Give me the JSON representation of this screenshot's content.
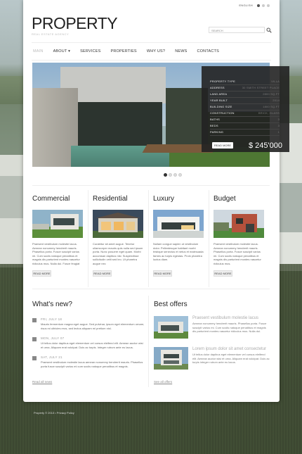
{
  "topbar": {
    "lang_label": "ENGLISH"
  },
  "logo": {
    "name": "PROPERTY",
    "tagline": "REAL ESTATE AGENCY"
  },
  "search": {
    "placeholder": "SEARCH"
  },
  "nav": {
    "items": [
      "MAIN",
      "ABOUT",
      "SERVICES",
      "PROPERTIES",
      "WHY US?",
      "NEWS",
      "CONTACTS"
    ]
  },
  "slider": {
    "info": [
      {
        "key": "PROPERTY TYPE",
        "value": "VILLA"
      },
      {
        "key": "ADDRESS",
        "value": "30 SMITH STREET PLACE"
      },
      {
        "key": "LAND AREA",
        "value": "2800 SQ.FT"
      },
      {
        "key": "YEAR BUILT",
        "value": "2014"
      },
      {
        "key": "BUILDING SIZE",
        "value": "1800 SQ.FT"
      },
      {
        "key": "CONSTRUCTION",
        "value": "BRICK, GLASS"
      },
      {
        "key": "BATHS",
        "value": "3"
      },
      {
        "key": "BEDS",
        "value": "3"
      },
      {
        "key": "PARKING",
        "value": "1"
      }
    ],
    "readmore_label": "READ MORE",
    "price": "$ 245'000"
  },
  "categories": [
    {
      "title": "Commercial",
      "desc": "Praesent vestibulum molestie lacus. Aenean nonummy hendrerit mauris. Phasellus porta. Fusce suscipit varius mi. Cum sociis natoque penatibus et magnis dis parturient montes nascetur ridiculus mus. Nulla dui. Fusce feugiat",
      "readmore": "READ MORE"
    },
    {
      "title": "Residential",
      "desc": "Curabitur sit amet augue. Tenetur ullamcorper mauris quis nulla sed ipsum porta. Nunc posuere eget quam. Morbi accumsan dapibus nisi. Suspendisse sollicitudin velit sed leo. Ut pharetra augue nec",
      "readmore": "READ MORE"
    },
    {
      "title": "Luxury",
      "desc": "Nullam congue sapien ut vestibulum dolor. Pellentesque habitant morbi tristique senectus et netus et malesuada fames ac turpis egestas. Proin pharetra luctus diam.",
      "readmore": "READ MORE"
    },
    {
      "title": "Budget",
      "desc": "Praesent vestibulum molestie lacus. Aenean nonummy hendrerit mauris. Phasellus porta. Fusce suscipit varius mi. Cum sociis natoque penatibus et magnis dis parturient montes nascetur ridiculus mus.",
      "readmore": "READ MORE"
    }
  ],
  "news": {
    "heading": "What's new?",
    "items": [
      {
        "date": "FRI, JULY 18",
        "text": "Mauris fermentum magna eget augue. Sed pulvinar, ipsum eget elementum ornare, risus mi ultricies eros, sed lectus aliquam mi pretium nisl."
      },
      {
        "date": "MON, JULY 07",
        "text": "Ut tellus dolor dapibus eget elementum vel cursus eleifend elit. Aenean auctor wisi et urna. Aliquam erat volutpat. Duis ac turpis. Integer rutrum ante eu lacus."
      },
      {
        "date": "SAT, JULY 21",
        "text": "Praesent vestibulum molestie lacus aenean nonummy hendrerit mauris. Phasellus porta fusce suscipit varius mi cum sociis natoque penatibus et magnis."
      }
    ],
    "more": "Read all news"
  },
  "offers": {
    "heading": "Best offers",
    "items": [
      {
        "title": "Praesent vestibulum molestie lacus",
        "desc": "Aenean nonummy hendrerit mauris. Phasellus porta. Fusce suscipit varius mi. Cum sociis natoque penatibus et magnis dis parturient montes nascetur ridiculus mus. Nulla dui."
      },
      {
        "title": "Lorem ipsum dolor sit amet consectetur",
        "desc": "Ut tellus dolor dapibus eget elementum vel cursus eleifend elit. Aenean auctor wisi et urna. Aliquam erat volutpat. Duis ac turpis integer rutrum ante eu lacus."
      }
    ],
    "more": "See all offers"
  },
  "footer": {
    "text": "Property © 2013 • Privacy Policy"
  }
}
